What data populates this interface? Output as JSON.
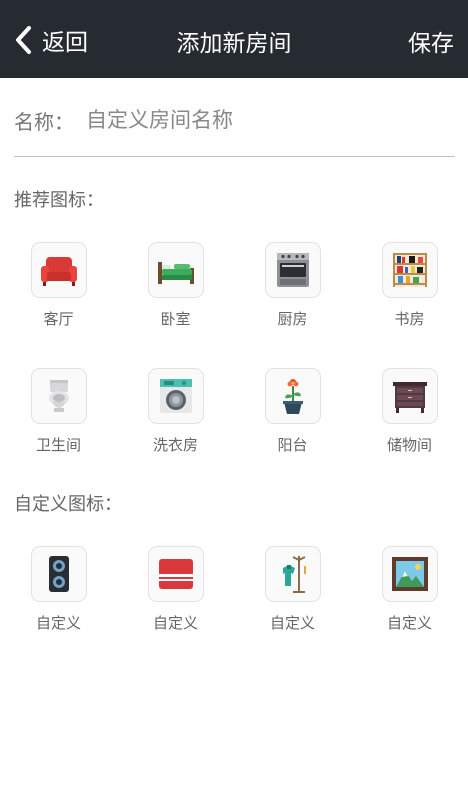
{
  "header": {
    "back_label": "返回",
    "title": "添加新房间",
    "save_label": "保存"
  },
  "name_field": {
    "label": "名称：",
    "placeholder": "自定义房间名称",
    "value": ""
  },
  "recommended": {
    "title": "推荐图标：",
    "items": [
      {
        "label": "客厅",
        "icon": "sofa-icon"
      },
      {
        "label": "卧室",
        "icon": "bed-icon"
      },
      {
        "label": "厨房",
        "icon": "oven-icon"
      },
      {
        "label": "书房",
        "icon": "bookshelf-icon"
      },
      {
        "label": "卫生间",
        "icon": "toilet-icon"
      },
      {
        "label": "洗衣房",
        "icon": "washing-machine-icon"
      },
      {
        "label": "阳台",
        "icon": "potted-flower-icon"
      },
      {
        "label": "储物间",
        "icon": "cabinet-icon"
      }
    ]
  },
  "custom": {
    "title": "自定义图标：",
    "items": [
      {
        "label": "自定义",
        "icon": "speaker-icon"
      },
      {
        "label": "自定义",
        "icon": "pillow-icon"
      },
      {
        "label": "自定义",
        "icon": "coat-rack-icon"
      },
      {
        "label": "自定义",
        "icon": "picture-frame-icon"
      }
    ]
  }
}
